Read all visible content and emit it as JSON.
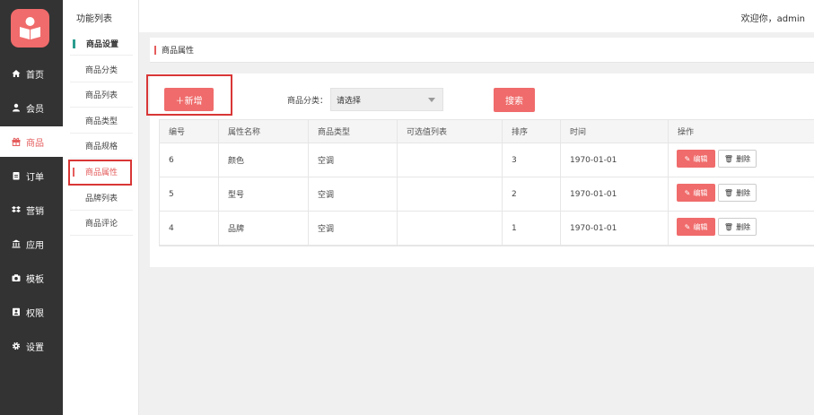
{
  "header": {
    "title": "功能列表",
    "welcome": "欢迎你，admin"
  },
  "nav": {
    "items": [
      {
        "label": "首页",
        "icon": "home-icon"
      },
      {
        "label": "会员",
        "icon": "user-icon"
      },
      {
        "label": "商品",
        "icon": "gift-icon",
        "active": true
      },
      {
        "label": "订单",
        "icon": "clipboard-icon"
      },
      {
        "label": "营销",
        "icon": "dropbox-icon"
      },
      {
        "label": "应用",
        "icon": "bank-icon"
      },
      {
        "label": "模板",
        "icon": "camera-icon"
      },
      {
        "label": "权限",
        "icon": "id-card-icon"
      },
      {
        "label": "设置",
        "icon": "gear-icon"
      }
    ]
  },
  "subnav": {
    "group": "商品设置",
    "items": [
      "商品分类",
      "商品列表",
      "商品类型",
      "商品规格",
      "商品属性",
      "品牌列表",
      "商品评论"
    ],
    "active_index": 4
  },
  "breadcrumb": "商品属性",
  "toolbar": {
    "add_label": "＋新增",
    "filter_label": "商品分类：",
    "select_value": "请选择",
    "search_label": "搜索"
  },
  "table": {
    "headers": [
      "编号",
      "属性名称",
      "商品类型",
      "可选值列表",
      "排序",
      "时间",
      "操作"
    ],
    "rows": [
      {
        "id": "6",
        "name": "颜色",
        "type": "空调",
        "values": "",
        "sort": "3",
        "time": "1970-01-01"
      },
      {
        "id": "5",
        "name": "型号",
        "type": "空调",
        "values": "",
        "sort": "2",
        "time": "1970-01-01"
      },
      {
        "id": "4",
        "name": "品牌",
        "type": "空调",
        "values": "",
        "sort": "1",
        "time": "1970-01-01"
      }
    ],
    "edit_label": "编辑",
    "delete_label": "删除"
  },
  "colors": {
    "accent": "#f06b6b",
    "sidebar": "#333333",
    "highlight": "#d93636"
  }
}
